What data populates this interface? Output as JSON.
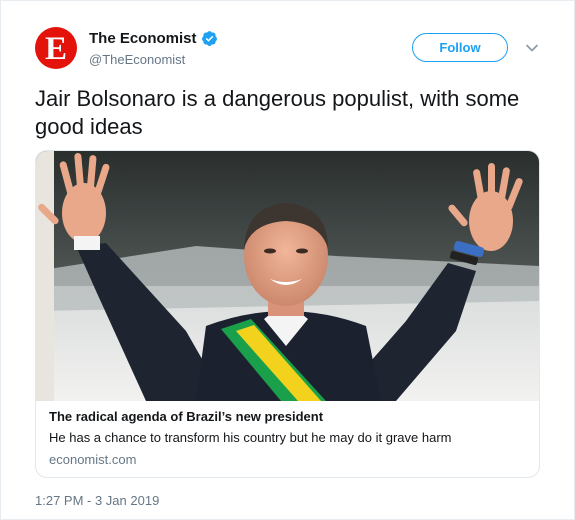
{
  "author": {
    "display_name": "The Economist",
    "handle": "@TheEconomist",
    "avatar_letter": "E",
    "avatar_color": "#e3120b",
    "verified": true,
    "verified_icon": "verified-badge-icon"
  },
  "actions": {
    "follow_label": "Follow",
    "menu_icon": "chevron-down-icon"
  },
  "tweet": {
    "text": "Jair Bolsonaro is a dangerous populist, with some good ideas",
    "timestamp": "1:27 PM - 3 Jan 2019"
  },
  "card": {
    "image_description_icon": "photo",
    "title": "The radical agenda of Brazil’s new president",
    "description": "He has a chance to transform his country but he may do it grave harm",
    "domain": "economist.com"
  },
  "colors": {
    "accent": "#1da1f2",
    "text": "#14171a",
    "secondary_text": "#657786",
    "border": "#e1e8ed"
  }
}
